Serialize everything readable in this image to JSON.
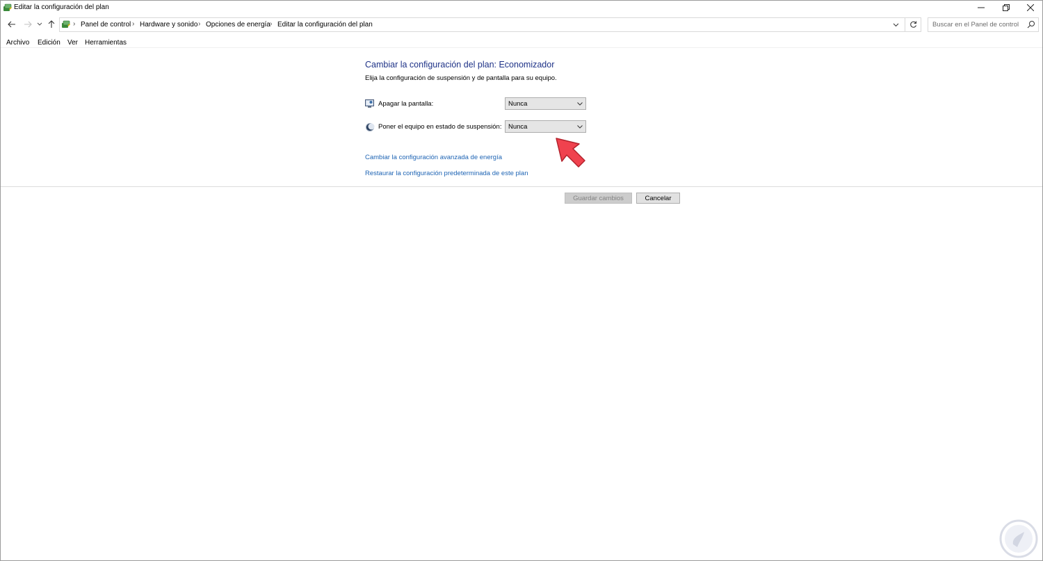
{
  "window": {
    "title": "Editar la configuración del plan"
  },
  "breadcrumb": {
    "items": [
      "Panel de control",
      "Hardware y sonido",
      "Opciones de energía",
      "Editar la configuración del plan"
    ],
    "separator": "›"
  },
  "search": {
    "placeholder": "Buscar en el Panel de control"
  },
  "menu": {
    "items": [
      "Archivo",
      "Edición",
      "Ver",
      "Herramientas"
    ]
  },
  "main": {
    "heading": "Cambiar la configuración del plan: Economizador",
    "subheading": "Elija la configuración de suspensión y de pantalla para su equipo.",
    "settings": [
      {
        "label": "Apagar la pantalla:",
        "value": "Nunca",
        "icon": "monitor-icon"
      },
      {
        "label": "Poner el equipo en estado de suspensión:",
        "value": "Nunca",
        "icon": "moon-icon"
      }
    ],
    "links": [
      "Cambiar la configuración avanzada de energía",
      "Restaurar la configuración predeterminada de este plan"
    ]
  },
  "buttons": {
    "save": "Guardar cambios",
    "cancel": "Cancelar"
  },
  "colors": {
    "heading": "#1e3287",
    "link": "#1e64b4",
    "pointer_arrow": "#f0424e"
  }
}
